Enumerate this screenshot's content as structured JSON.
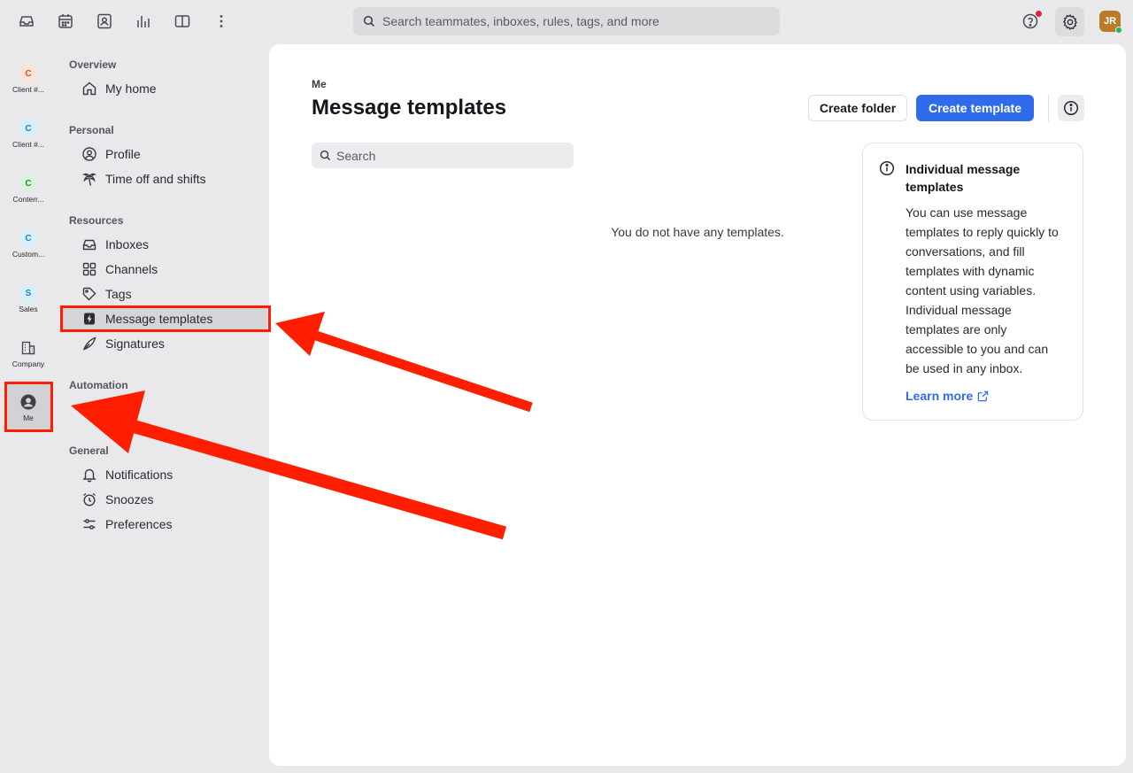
{
  "topbar": {
    "search_placeholder": "Search teammates, inboxes, rules, tags, and more",
    "avatar_initials": "JR"
  },
  "workspaces": [
    {
      "initial": "C",
      "label": "Client #...",
      "bg": "#fde3d6",
      "fg": "#d4562a"
    },
    {
      "initial": "C",
      "label": "Client #...",
      "bg": "#d7effa",
      "fg": "#1f86b8"
    },
    {
      "initial": "C",
      "label": "Conterr...",
      "bg": "#d9f3df",
      "fg": "#248a3c"
    },
    {
      "initial": "C",
      "label": "Custom...",
      "bg": "#d7effa",
      "fg": "#1f86b8"
    },
    {
      "initial": "S",
      "label": "Sales",
      "bg": "#d7effa",
      "fg": "#1f86b8"
    },
    {
      "label": "Company"
    },
    {
      "label": "Me"
    }
  ],
  "nav": {
    "sections": {
      "overview": "Overview",
      "personal": "Personal",
      "resources": "Resources",
      "automation": "Automation",
      "general": "General"
    },
    "items": {
      "my_home": "My home",
      "profile": "Profile",
      "time_off": "Time off and shifts",
      "inboxes": "Inboxes",
      "channels": "Channels",
      "tags": "Tags",
      "message_templates": "Message templates",
      "signatures": "Signatures",
      "notifications": "Notifications",
      "snoozes": "Snoozes",
      "preferences": "Preferences"
    }
  },
  "main": {
    "breadcrumb": "Me",
    "title": "Message templates",
    "create_folder": "Create folder",
    "create_template": "Create template",
    "search_placeholder": "Search",
    "empty_message": "You do not have any templates.",
    "info": {
      "heading": "Individual message templates",
      "body": "You can use message templates to reply quickly to conversations, and fill templates with dynamic content using variables. Individual message templates are only accessible to you and can be used in any inbox.",
      "learn_more": "Learn more"
    }
  },
  "colors": {
    "accent": "#2f6bea",
    "annotation": "#ff1f00"
  }
}
